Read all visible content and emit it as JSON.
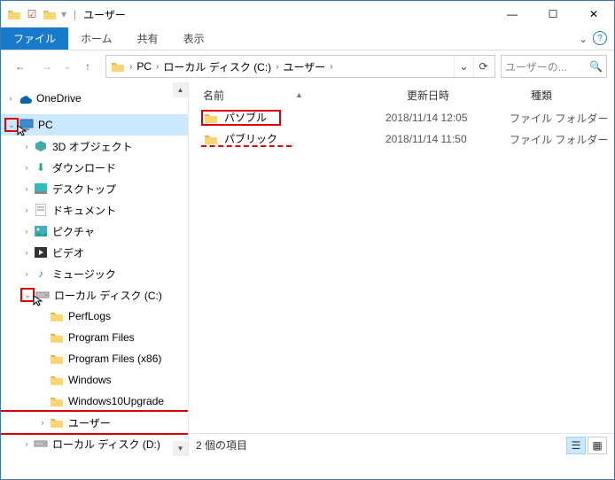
{
  "window": {
    "title": "ユーザー",
    "min": "—",
    "max": "☐",
    "close": "✕"
  },
  "ribbon": {
    "file": "ファイル",
    "tabs": [
      "ホーム",
      "共有",
      "表示"
    ]
  },
  "nav": {
    "back": "←",
    "forward": "→",
    "up": "↑",
    "history": "⌄",
    "refresh": "⟳",
    "breadcrumbs": [
      "PC",
      "ローカル ディスク (C:)",
      "ユーザー"
    ]
  },
  "search": {
    "placeholder": "ユーザーの..."
  },
  "tree": {
    "items": [
      {
        "indent": 0,
        "icon": "onedrive",
        "label": "OneDrive",
        "twist": ">"
      },
      {
        "indent": 0,
        "icon": "pc",
        "label": "PC",
        "twist": "v",
        "selected": true,
        "redbox": "twist",
        "cursor": true
      },
      {
        "indent": 1,
        "icon": "3d",
        "label": "3D オブジェクト",
        "twist": ">"
      },
      {
        "indent": 1,
        "icon": "download",
        "label": "ダウンロード",
        "twist": ">"
      },
      {
        "indent": 1,
        "icon": "desktop",
        "label": "デスクトップ",
        "twist": ">"
      },
      {
        "indent": 1,
        "icon": "document",
        "label": "ドキュメント",
        "twist": ">"
      },
      {
        "indent": 1,
        "icon": "picture",
        "label": "ピクチャ",
        "twist": ">"
      },
      {
        "indent": 1,
        "icon": "video",
        "label": "ビデオ",
        "twist": ">"
      },
      {
        "indent": 1,
        "icon": "music",
        "label": "ミュージック",
        "twist": ">"
      },
      {
        "indent": 1,
        "icon": "drive",
        "label": "ローカル ディスク (C:)",
        "twist": "v",
        "redbox": "twist",
        "cursor": true
      },
      {
        "indent": 2,
        "icon": "folder",
        "label": "PerfLogs",
        "twist": ""
      },
      {
        "indent": 2,
        "icon": "folder",
        "label": "Program Files",
        "twist": ""
      },
      {
        "indent": 2,
        "icon": "folder",
        "label": "Program Files (x86)",
        "twist": ""
      },
      {
        "indent": 2,
        "icon": "folder",
        "label": "Windows",
        "twist": ""
      },
      {
        "indent": 2,
        "icon": "folder",
        "label": "Windows10Upgrade",
        "twist": ""
      },
      {
        "indent": 2,
        "icon": "folder",
        "label": "ユーザー",
        "twist": ">",
        "redbox": "row"
      },
      {
        "indent": 1,
        "icon": "drive",
        "label": "ローカル ディスク (D:)",
        "twist": ">"
      }
    ]
  },
  "columns": {
    "name": "名前",
    "date": "更新日時",
    "type": "種類"
  },
  "files": [
    {
      "name": "パソブル",
      "date": "2018/11/14 12:05",
      "type": "ファイル フォルダー",
      "hl": "solid"
    },
    {
      "name": "パブリック",
      "date": "2018/11/14 11:50",
      "type": "ファイル フォルダー",
      "hl": "dashed"
    }
  ],
  "status": {
    "count": "2 個の項目"
  }
}
